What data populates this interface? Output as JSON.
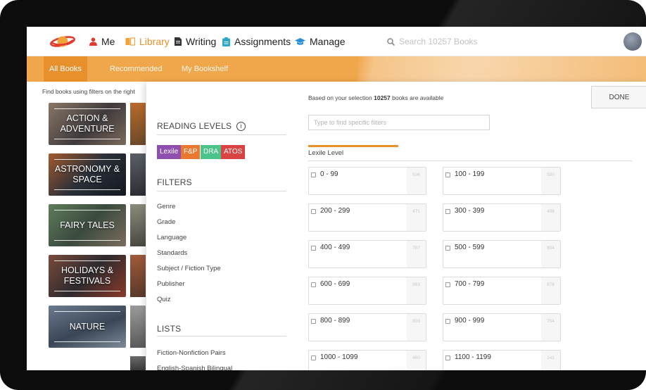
{
  "nav": {
    "me": "Me",
    "library": "Library",
    "writing": "Writing",
    "assignments": "Assignments",
    "manage": "Manage",
    "search_placeholder": "Search 10257 Books"
  },
  "subnav": {
    "tabs": [
      "All Books",
      "Recommended",
      "My Bookshelf"
    ]
  },
  "catalog": {
    "hint": "Find books using filters on the right",
    "categories": [
      "ACTION & ADVENTURE",
      "ASTRONOMY & SPACE",
      "FAIRY TALES",
      "HOLIDAYS & FESTIVALS",
      "NATURE"
    ]
  },
  "panel": {
    "reading_levels_title": "READING LEVELS",
    "reading_level_chips": [
      {
        "label": "Lexile",
        "color": "#8e4fb0"
      },
      {
        "label": "F&P",
        "color": "#e8792e"
      },
      {
        "label": "DRA",
        "color": "#4cc38a"
      },
      {
        "label": "ATOS",
        "color": "#d94343"
      }
    ],
    "filters_title": "FILTERS",
    "filters": [
      "Genre",
      "Grade",
      "Language",
      "Standards",
      "Subject / Fiction Type",
      "Publisher",
      "Quiz"
    ],
    "lists_title": "LISTS",
    "lists": [
      "Fiction-Nonfiction Pairs",
      "English-Spanish Bilingual"
    ],
    "selection_prefix": "Based on your selection",
    "selection_count": "10257",
    "selection_suffix": "books are available",
    "done_label": "DONE",
    "filter_placeholder": "Type to find specific filters",
    "active_tab": "Lexile Level",
    "ranges": [
      {
        "label": "0 - 99",
        "count": "506"
      },
      {
        "label": "100 - 199",
        "count": "500"
      },
      {
        "label": "200 - 299",
        "count": "471"
      },
      {
        "label": "300 - 399",
        "count": "496"
      },
      {
        "label": "400 - 499",
        "count": "787"
      },
      {
        "label": "500 - 599",
        "count": "804"
      },
      {
        "label": "600 - 699",
        "count": "963"
      },
      {
        "label": "700 - 799",
        "count": "878"
      },
      {
        "label": "800 - 899",
        "count": "803"
      },
      {
        "label": "900 - 999",
        "count": "754"
      },
      {
        "label": "1000 - 1099",
        "count": "460"
      },
      {
        "label": "1100 - 1199",
        "count": "141"
      }
    ]
  },
  "colors": {
    "accent": "#e8902c",
    "subnav": "#f0a64a"
  }
}
